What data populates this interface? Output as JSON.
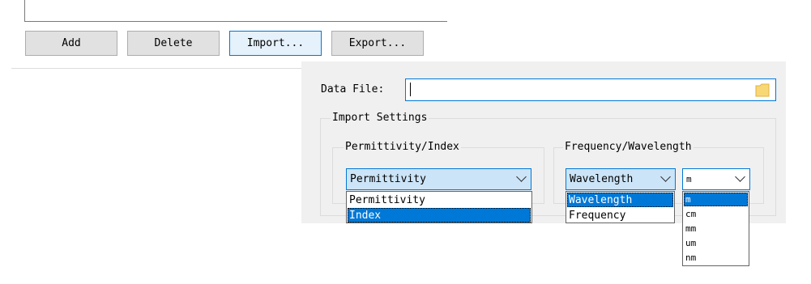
{
  "background": {
    "buttons": {
      "add": "Add",
      "delete": "Delete",
      "import": "Import...",
      "export": "Export..."
    }
  },
  "import_panel": {
    "data_file": {
      "label": "Data File:",
      "value": ""
    },
    "import_settings": {
      "legend": "Import Settings",
      "permittivity_group": {
        "legend": "Permittivity/Index",
        "selected": "Permittivity",
        "options": [
          "Permittivity",
          "Index"
        ],
        "highlighted": "Index"
      },
      "frequency_group": {
        "legend": "Frequency/Wavelength",
        "selected": "Wavelength",
        "options": [
          "Wavelength",
          "Frequency"
        ],
        "highlighted": "Wavelength",
        "unit": {
          "selected": "m",
          "options": [
            "m",
            "cm",
            "mm",
            "um",
            "nm"
          ],
          "highlighted": "m"
        }
      }
    }
  },
  "colors": {
    "accent": "#0078d7",
    "panel_bg": "#f0f0f0",
    "combo_bg": "#cce4f7",
    "button_bg": "#e1e1e1"
  },
  "icons": {
    "data_file_browse": "folder-icon",
    "combo": "chevron-down-icon"
  }
}
